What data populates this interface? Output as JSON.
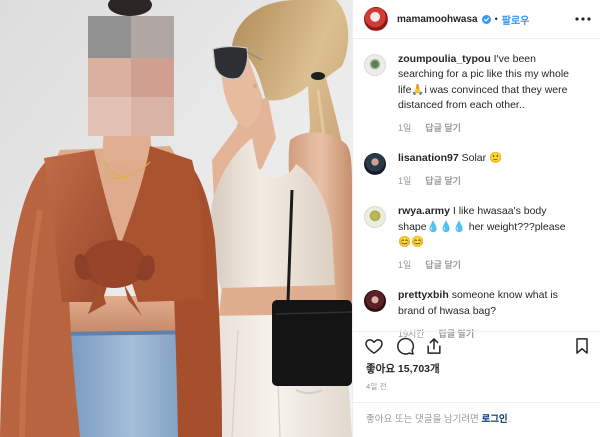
{
  "header": {
    "username": "mamamoohwasa",
    "verified": true,
    "separator": "•",
    "follow_label": "팔로우",
    "verified_icon": "verified-badge-icon",
    "more_icon": "more-options-icon"
  },
  "comments": [
    {
      "username": "zoumpoulia_typou",
      "text": "I've been searching for a pic like this my whole life🙏i was convinced that they were distanced from each other..",
      "time": "1일",
      "reply_label": "답글 달기"
    },
    {
      "username": "lisanation97",
      "text": "Solar 🙂",
      "time": "1일",
      "reply_label": "답글 달기"
    },
    {
      "username": "rwya.army",
      "text": "I like hwasaa's body shape💧💧💧 her weight???please😊😊",
      "time": "1일",
      "reply_label": "답글 달기"
    },
    {
      "username": "prettyxbih",
      "text": "someone know what is brand of hwasa bag?",
      "time": "19시간",
      "reply_label": "답글 달기"
    }
  ],
  "actions": {
    "like_icon": "heart-icon",
    "comment_icon": "comment-icon",
    "share_icon": "share-icon",
    "save_icon": "bookmark-icon"
  },
  "likes": {
    "label": "좋아요",
    "count": "15,703",
    "unit": "개"
  },
  "posted": "4일 전",
  "login_prompt": {
    "text": "좋아요 또는 댓글을 남기려면",
    "link_label": "로그인",
    "suffix": "."
  },
  "colors": {
    "accent": "#3897f0",
    "text": "#262626",
    "muted": "#999999",
    "border": "#efefef",
    "link": "#003569"
  }
}
